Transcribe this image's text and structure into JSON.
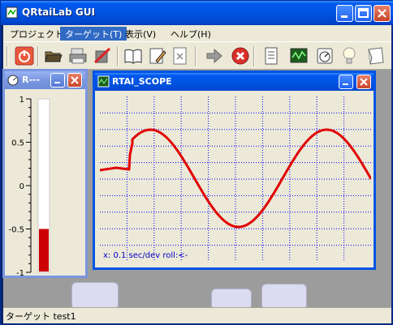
{
  "app": {
    "title": "QRtaiLab GUI"
  },
  "menu": {
    "items": [
      {
        "label": "プロジェクト"
      },
      {
        "label": "ターゲット(T)"
      },
      {
        "label": "表示(V)"
      },
      {
        "label": "ヘルプ(H)"
      }
    ]
  },
  "toolbar": {
    "icons": [
      "power-icon",
      "open-folder-icon",
      "print-icon",
      "delete-icon",
      "book-icon",
      "edit-icon",
      "close-doc-icon",
      "arrow-right-icon",
      "stop-icon",
      "document-icon",
      "scope-icon",
      "meter-icon",
      "bulb-icon",
      "paper-icon"
    ]
  },
  "meter_window": {
    "title": "R---",
    "scale": [
      "1",
      "0.5",
      "0",
      "-0.5",
      "-1"
    ],
    "value": -0.5,
    "fill_color": "#cc0000"
  },
  "scope_window": {
    "title": "RTAI_SCOPE",
    "status": "x: 0.1 sec/dev   roll:<-",
    "trace_color": "#e00000",
    "grid_color": "#0000ff"
  },
  "statusbar": {
    "text": "ターゲット test1"
  }
}
